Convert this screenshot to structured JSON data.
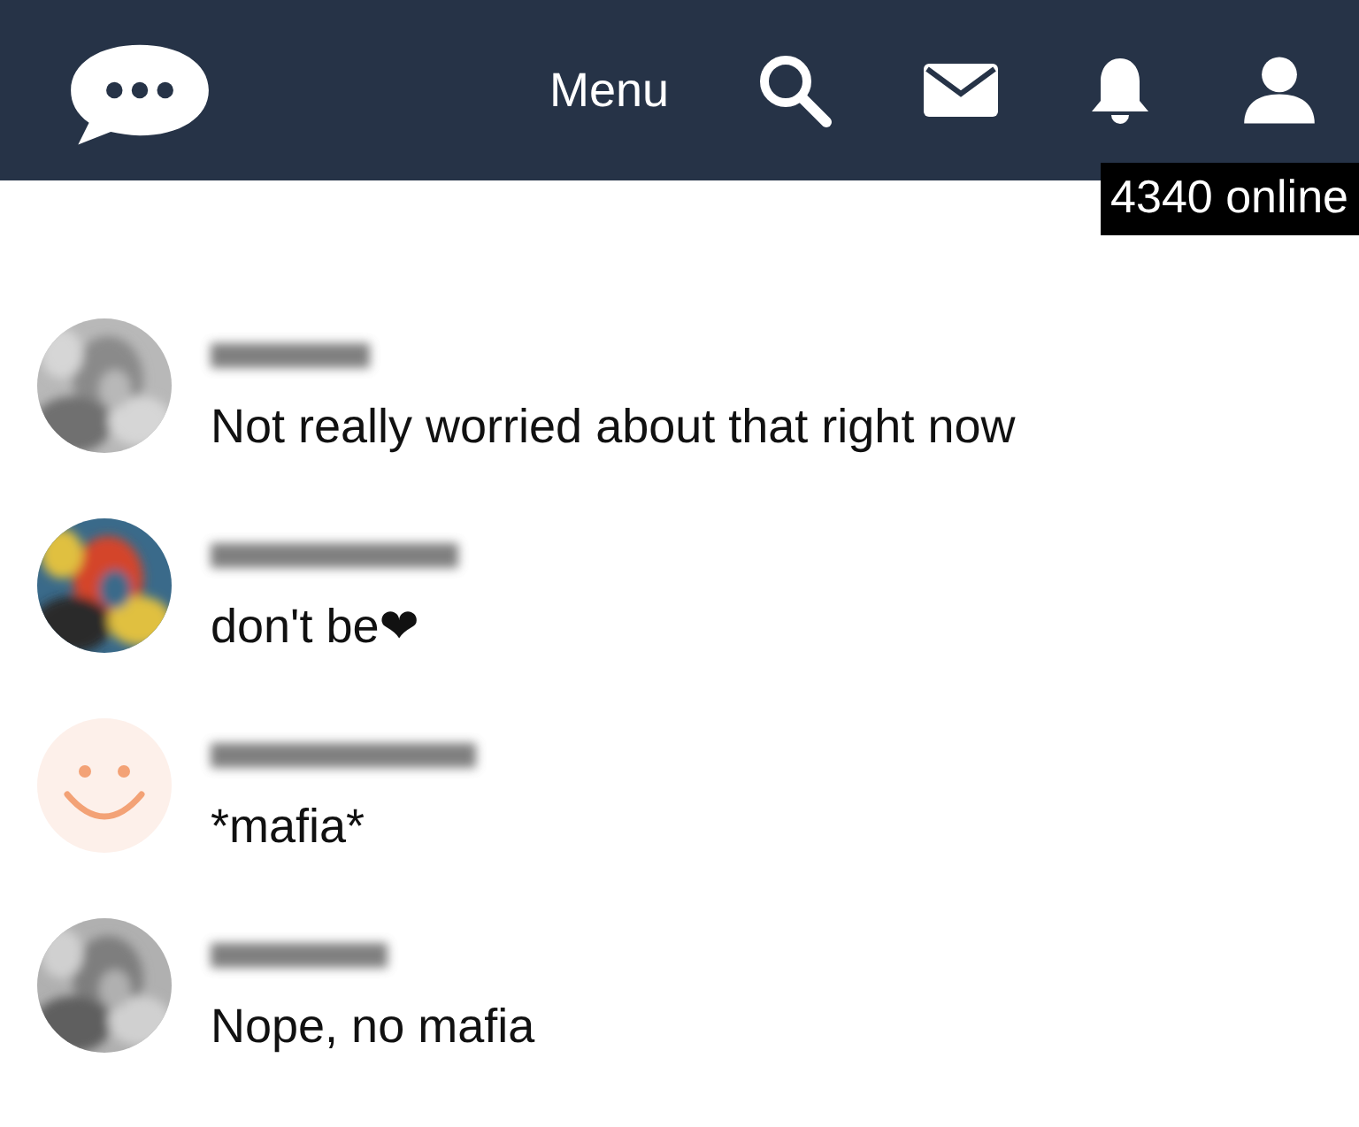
{
  "header": {
    "menu_label": "Menu",
    "online_badge": "4340 online"
  },
  "messages": [
    {
      "text": "Not really worried about that right now"
    },
    {
      "text": "don't be❤"
    },
    {
      "avatar": {
        "kind": "smiley"
      },
      "text": "*mafia*"
    },
    {
      "text": "Nope, no mafia"
    }
  ]
}
